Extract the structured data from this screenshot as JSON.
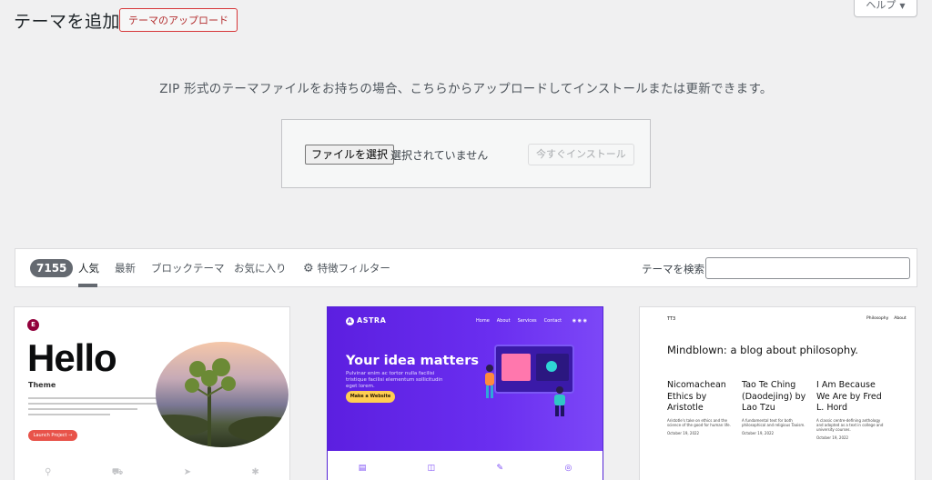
{
  "header": {
    "title": "テーマを追加",
    "upload_label": "テーマのアップロード",
    "help_label": "ヘルプ"
  },
  "upload": {
    "description": "ZIP 形式のテーマファイルをお持ちの場合、こちらからアップロードしてインストールまたは更新できます。",
    "choose_file_label": "ファイルを選択",
    "no_file_text": "選択されていません",
    "install_label": "今すぐインストール"
  },
  "filters": {
    "count": "7155",
    "tabs": [
      "人気",
      "最新",
      "ブロックテーマ",
      "お気に入り"
    ],
    "feature_filter_label": "特徴フィルター",
    "search_label": "テーマを検索",
    "search_value": ""
  },
  "themes": [
    {
      "preview": {
        "badge": "E",
        "headline": "Hello",
        "subtitle": "Theme",
        "button": "Launch Project →"
      }
    },
    {
      "preview": {
        "logo": "ASTRA",
        "nav": [
          "Home",
          "About",
          "Services",
          "Contact"
        ],
        "headline": "Your idea matters",
        "copy": "Pulvinar enim ac tortor nulla facilisi tristique facilisi elementum sollicitudin eget lorem.",
        "button": "Make a Website"
      }
    },
    {
      "preview": {
        "brand": "TT3",
        "nav": [
          "Philosophy",
          "About"
        ],
        "headline": "Mindblown: a blog about philosophy.",
        "posts": [
          {
            "title": "Nicomachean Ethics by Aristotle",
            "desc": "Aristotle's take on ethics and the science of the good for human life.",
            "date": "October 19, 2022"
          },
          {
            "title": "Tao Te Ching (Daodejing) by Lao Tzu",
            "desc": "A fundamental text for both philosophical and religious Taoism.",
            "date": "October 19, 2022"
          },
          {
            "title": "I Am Because We Are by Fred L. Hord",
            "desc": "A classic centre-defining anthology and adopted as a text in college and university courses.",
            "date": "October 19, 2022"
          }
        ]
      }
    }
  ],
  "colors": {
    "accent_red": "#d63638",
    "astra_purple": "#5c1fe0",
    "astra_yellow": "#ffce52"
  }
}
